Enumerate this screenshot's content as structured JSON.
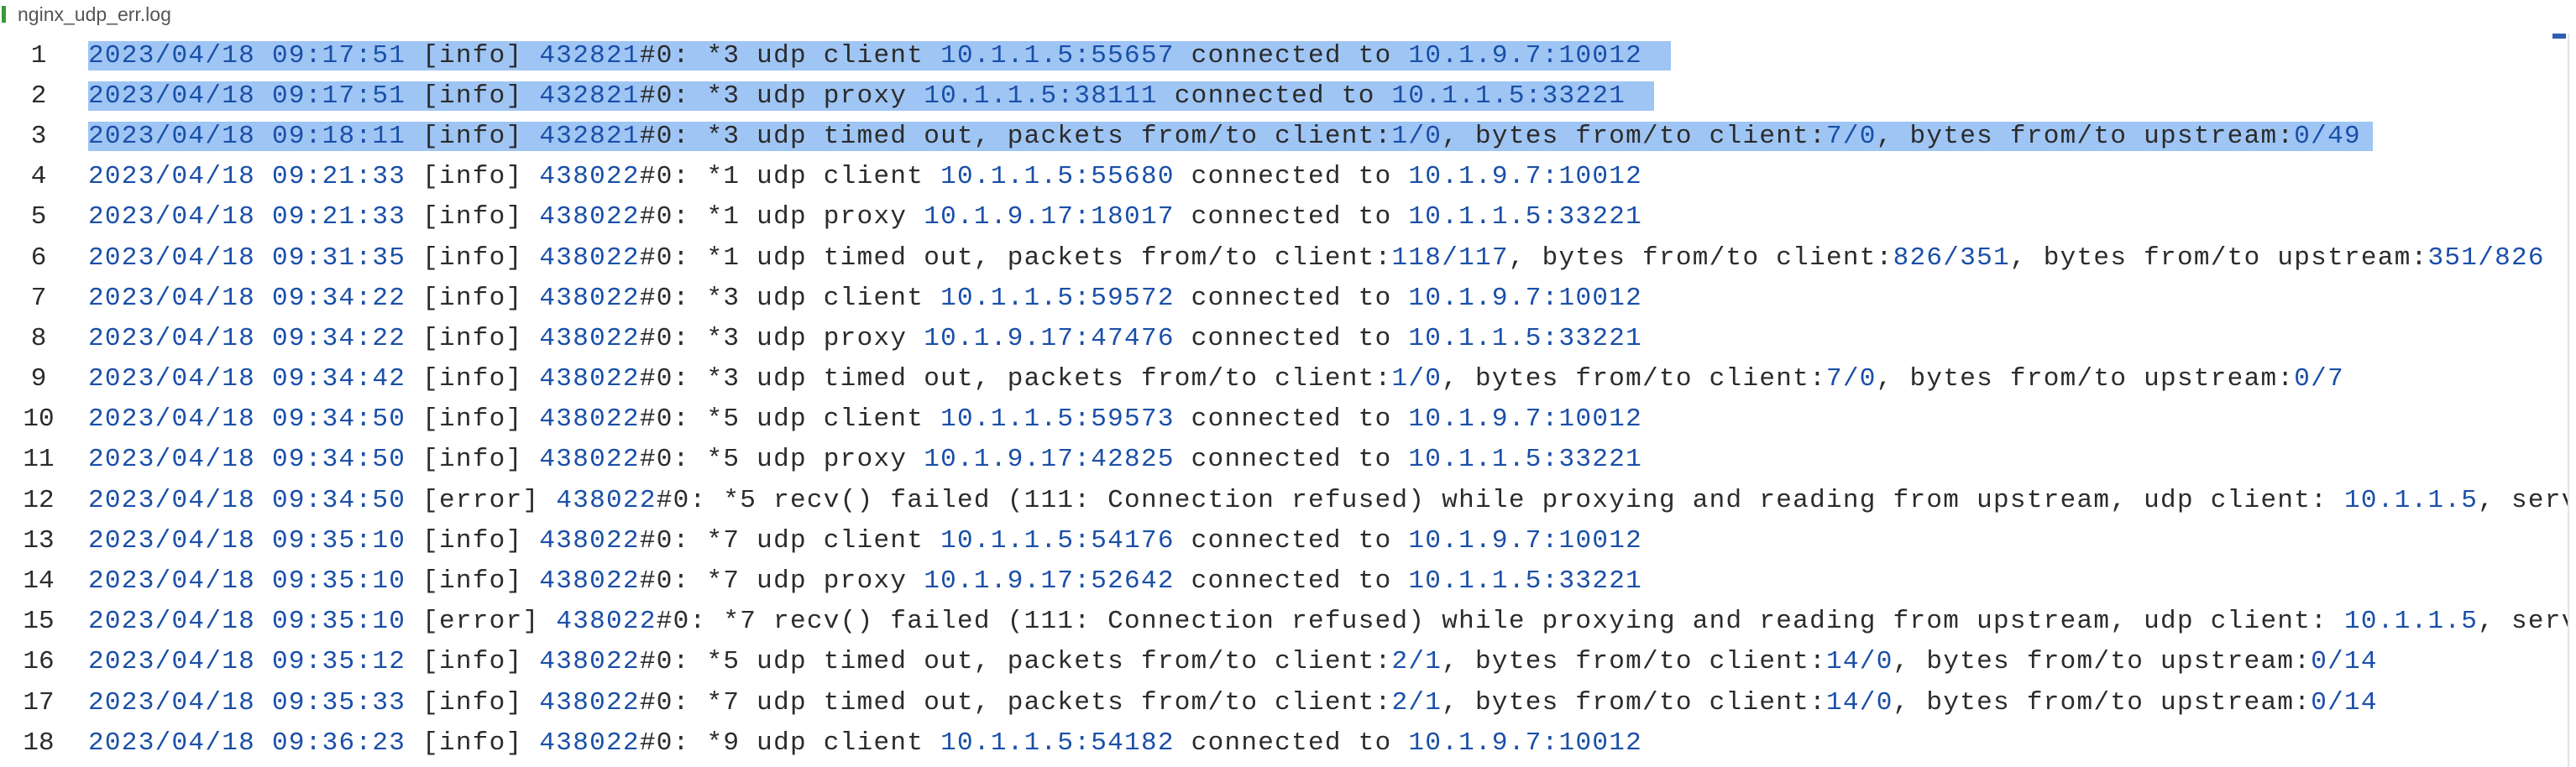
{
  "tab": {
    "file_name": "nginx_udp_err.log",
    "icon": "file-icon"
  },
  "colors": {
    "number": "#1a4fa8",
    "text": "#2b2b2b",
    "selection": "#9fc5f4"
  },
  "editor": {
    "lines": [
      {
        "no": "1",
        "date": "2023/04/18",
        "time": "09:17:51",
        "text": " [info] 432821#0: *3 udp client 10.1.1.5:55657 connected to 10.1.9.7:10012 "
      },
      {
        "no": "2",
        "date": "2023/04/18",
        "time": "09:17:51",
        "text": " [info] 432821#0: *3 udp proxy 10.1.1.5:38111 connected to 10.1.1.5:33221 "
      },
      {
        "no": "3",
        "date": "2023/04/18",
        "time": "09:18:11",
        "text": " [info] 432821#0: *3 udp timed out, packets from/to client:1/0, bytes from/to client:7/0, bytes from/to upstream:0/49"
      },
      {
        "no": "4",
        "date": "2023/04/18",
        "time": "09:21:33",
        "text": " [info] 438022#0: *1 udp client 10.1.1.5:55680 connected to 10.1.9.7:10012"
      },
      {
        "no": "5",
        "date": "2023/04/18",
        "time": "09:21:33",
        "text": " [info] 438022#0: *1 udp proxy 10.1.9.17:18017 connected to 10.1.1.5:33221"
      },
      {
        "no": "6",
        "date": "2023/04/18",
        "time": "09:31:35",
        "text": " [info] 438022#0: *1 udp timed out, packets from/to client:118/117, bytes from/to client:826/351, bytes from/to upstream:351/826"
      },
      {
        "no": "7",
        "date": "2023/04/18",
        "time": "09:34:22",
        "text": " [info] 438022#0: *3 udp client 10.1.1.5:59572 connected to 10.1.9.7:10012"
      },
      {
        "no": "8",
        "date": "2023/04/18",
        "time": "09:34:22",
        "text": " [info] 438022#0: *3 udp proxy 10.1.9.17:47476 connected to 10.1.1.5:33221"
      },
      {
        "no": "9",
        "date": "2023/04/18",
        "time": "09:34:42",
        "text": " [info] 438022#0: *3 udp timed out, packets from/to client:1/0, bytes from/to client:7/0, bytes from/to upstream:0/7"
      },
      {
        "no": "10",
        "date": "2023/04/18",
        "time": "09:34:50",
        "text": " [info] 438022#0: *5 udp client 10.1.1.5:59573 connected to 10.1.9.7:10012"
      },
      {
        "no": "11",
        "date": "2023/04/18",
        "time": "09:34:50",
        "text": " [info] 438022#0: *5 udp proxy 10.1.9.17:42825 connected to 10.1.1.5:33221"
      },
      {
        "no": "12",
        "date": "2023/04/18",
        "time": "09:34:50",
        "text": " [error] 438022#0: *5 recv() failed (111: Connection refused) while proxying and reading from upstream, udp client: 10.1.1.5, serv"
      },
      {
        "no": "13",
        "date": "2023/04/18",
        "time": "09:35:10",
        "text": " [info] 438022#0: *7 udp client 10.1.1.5:54176 connected to 10.1.9.7:10012"
      },
      {
        "no": "14",
        "date": "2023/04/18",
        "time": "09:35:10",
        "text": " [info] 438022#0: *7 udp proxy 10.1.9.17:52642 connected to 10.1.1.5:33221"
      },
      {
        "no": "15",
        "date": "2023/04/18",
        "time": "09:35:10",
        "text": " [error] 438022#0: *7 recv() failed (111: Connection refused) while proxying and reading from upstream, udp client: 10.1.1.5, serv"
      },
      {
        "no": "16",
        "date": "2023/04/18",
        "time": "09:35:12",
        "text": " [info] 438022#0: *5 udp timed out, packets from/to client:2/1, bytes from/to client:14/0, bytes from/to upstream:0/14"
      },
      {
        "no": "17",
        "date": "2023/04/18",
        "time": "09:35:33",
        "text": " [info] 438022#0: *7 udp timed out, packets from/to client:2/1, bytes from/to client:14/0, bytes from/to upstream:0/14"
      },
      {
        "no": "18",
        "date": "2023/04/18",
        "time": "09:36:23",
        "text": " [info] 438022#0: *9 udp client 10.1.1.5:54182 connected to 10.1.9.7:10012"
      }
    ]
  }
}
